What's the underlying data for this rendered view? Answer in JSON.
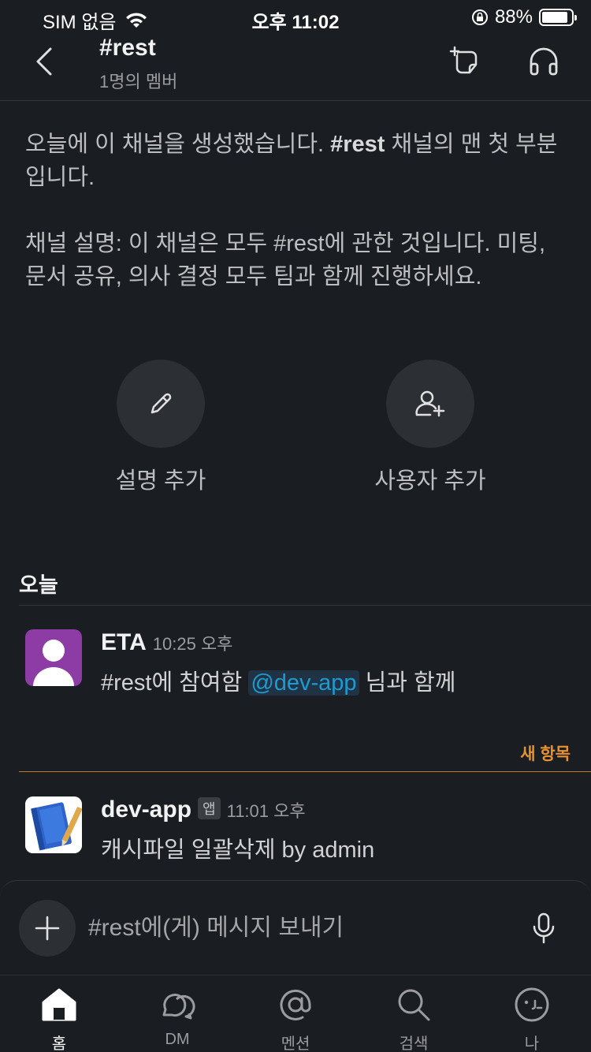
{
  "status_bar": {
    "carrier": "SIM 없음",
    "time": "오후 11:02",
    "battery": "88%",
    "battery_level": 0.88
  },
  "header": {
    "title": "#rest",
    "subtitle": "1명의 멤버"
  },
  "intro": {
    "line1_prefix": "오늘에 이 채널을 생성했습니다. ",
    "line1_channel": "#rest",
    "line1_suffix": " 채널의 맨 첫 부분입니다.",
    "description": "채널 설명: 이 채널은 모두 #rest에 관한 것입니다. 미팅, 문서 공유, 의사 결정 모두 팀과 함께 진행하세요."
  },
  "actions": {
    "add_description": "설명 추가",
    "add_user": "사용자 추가"
  },
  "day_label": "오늘",
  "messages": [
    {
      "sender": "ETA",
      "time": "10:25 오후",
      "text_prefix": "#rest에 참여함 ",
      "mention": "@dev-app",
      "text_suffix": " 님과 함께"
    },
    {
      "sender": "dev-app",
      "badge": "앱",
      "time": "11:01 오후",
      "text": "캐시파일 일괄삭제 by admin"
    }
  ],
  "new_items_label": "새 항목",
  "composer": {
    "placeholder": "#rest에(게) 메시지 보내기"
  },
  "tabs": [
    {
      "label": "홈",
      "icon": "home-icon",
      "active": true
    },
    {
      "label": "DM",
      "icon": "dm-icon",
      "active": false
    },
    {
      "label": "멘션",
      "icon": "mention-icon",
      "active": false
    },
    {
      "label": "검색",
      "icon": "search-icon",
      "active": false
    },
    {
      "label": "나",
      "icon": "profile-icon",
      "active": false
    }
  ],
  "colors": {
    "background": "#1a1d21",
    "mention": "#1d9bd1",
    "new_items": "#e8912d",
    "eta_avatar": "#8e3ca5"
  }
}
